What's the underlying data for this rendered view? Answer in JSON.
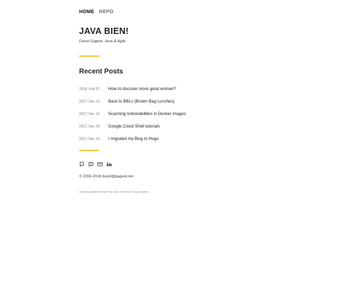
{
  "nav": {
    "items": [
      {
        "label": "HOME"
      },
      {
        "label": "REPO"
      }
    ]
  },
  "site": {
    "title": "JAVA BIEN!",
    "subtitle": "David Gageot, Java & Agile"
  },
  "recent_posts": {
    "heading": "Recent Posts",
    "items": [
      {
        "date": "2018, Feb 22",
        "title": "How to discover more great women?"
      },
      {
        "date": "2017, Dec 22",
        "title": "Back to BBLs (Brown Bag Lunches)"
      },
      {
        "date": "2017, Dec 21",
        "title": "Scanning Vulnerabilities in Docker images"
      },
      {
        "date": "2017, Dec 20",
        "title": "Google Cloud Shell tutorials"
      },
      {
        "date": "2017, Dec 19",
        "title": "I migrated my Blog to Hugo"
      }
    ]
  },
  "social": {
    "icons": [
      "twitter-icon",
      "github-icon",
      "email-icon",
      "linkedin-icon"
    ]
  },
  "footer": {
    "copyright": "© 2004-2018 david@gageot.net",
    "disclaimer": "Opinions stated here are my own, not those of my company."
  },
  "colors": {
    "accent": "#f6c944",
    "text": "#222222"
  }
}
